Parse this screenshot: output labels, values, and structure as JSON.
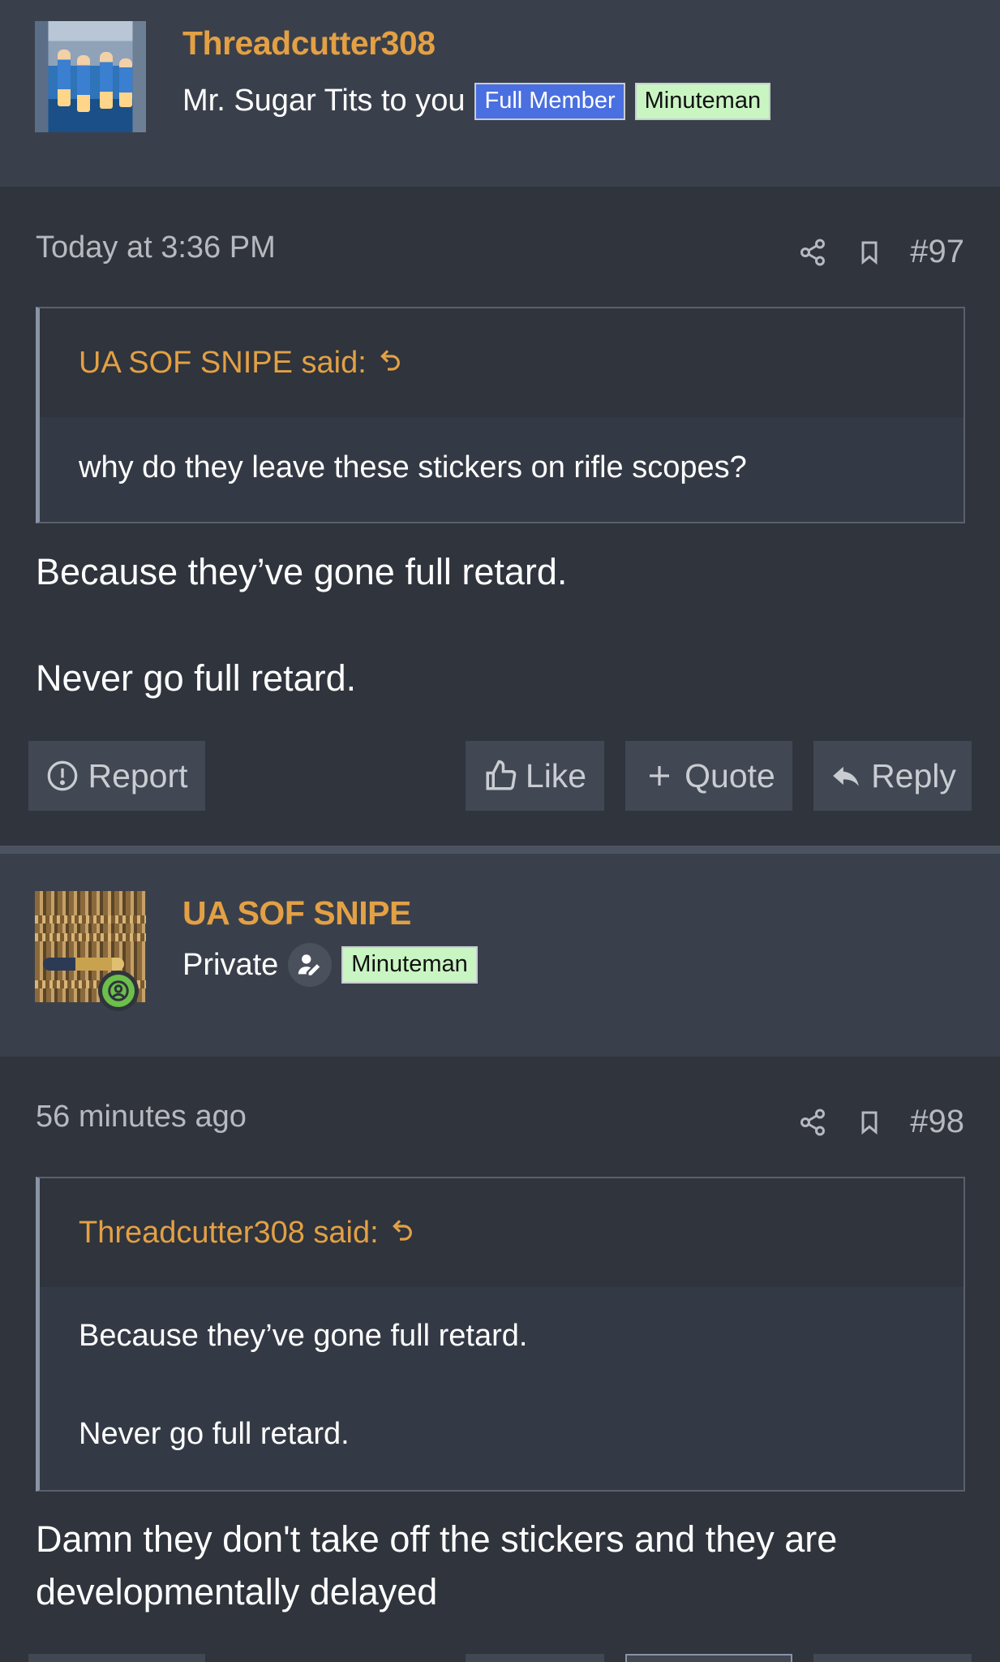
{
  "posts": [
    {
      "author": "Threadcutter308",
      "user_title": "Mr. Sugar Tits to you",
      "badges": [
        "Full Member",
        "Minuteman"
      ],
      "timestamp": "Today at 3:36 PM",
      "post_number": "#97",
      "quote": {
        "attribution": "UA SOF SNIPE said:",
        "lines": [
          "why do they leave these stickers on rifle scopes?"
        ]
      },
      "message": [
        "Because they’ve gone full retard.",
        "Never go full retard."
      ],
      "actions": {
        "report": "Report",
        "like": "Like",
        "quote": "Quote",
        "reply": "Reply"
      }
    },
    {
      "author": "UA SOF SNIPE",
      "user_title": "Private",
      "badges": [
        "Minuteman"
      ],
      "timestamp": "56 minutes ago",
      "post_number": "#98",
      "quote": {
        "attribution": "Threadcutter308 said:",
        "lines": [
          "Because they’ve gone full retard.",
          "Never go full retard."
        ]
      },
      "message": [
        "Damn they don't take off the stickers and they are developmentally delayed"
      ]
    }
  ],
  "colors": {
    "background": "#2f343d",
    "header_background": "#3a404b",
    "username": "#e3a044",
    "badge_full_member": "#4a6fe0",
    "badge_minuteman": "#c9f5c3",
    "online": "#6cc04a"
  },
  "icons": {
    "share": "share-icon",
    "bookmark": "bookmark-icon",
    "jump": "jump-to-quote-icon",
    "report": "report-icon",
    "like": "thumbs-up-icon",
    "quote": "plus-icon",
    "reply": "reply-icon",
    "staff": "user-edit-icon",
    "online": "online-status-icon"
  }
}
